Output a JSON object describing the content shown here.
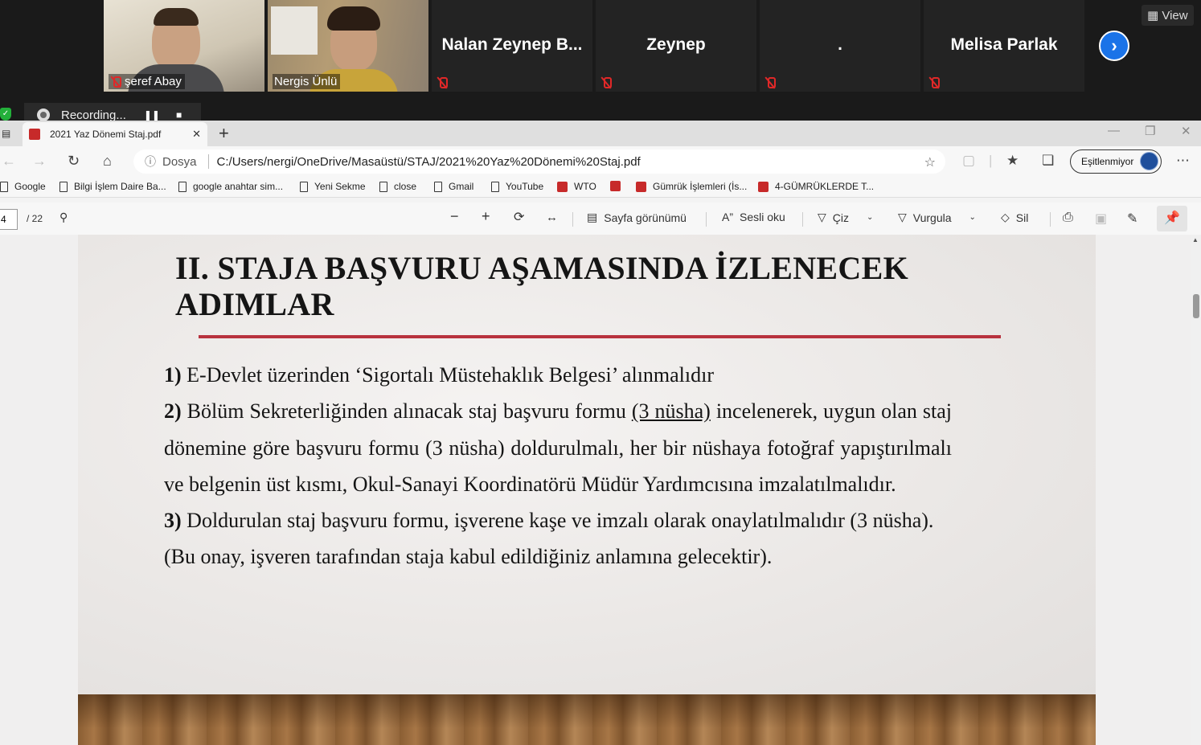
{
  "zoom": {
    "participants": [
      {
        "name": "şeref Abay",
        "muted": true
      },
      {
        "name": "Nergis Ünlü",
        "muted": false
      },
      {
        "name": "Nalan Zeynep B...",
        "muted": true
      },
      {
        "name": "Zeynep",
        "muted": true
      },
      {
        "name": ".",
        "muted": true
      },
      {
        "name": "Melisa Parlak",
        "muted": true
      }
    ],
    "view_label": "View",
    "recording_label": "Recording...",
    "next_icon": "chevron-right-icon"
  },
  "browser": {
    "tab_title": "2021 Yaz Dönemi Staj.pdf",
    "address": {
      "scheme_label": "Dosya",
      "url": "C:/Users/nergi/OneDrive/Masaüstü/STAJ/2021%20Yaz%20Dönemi%20Staj.pdf"
    },
    "profile_label": "Eşitlenmiyor",
    "bookmarks": [
      {
        "label": "Google",
        "icon": "doc"
      },
      {
        "label": "Bilgi İşlem Daire Ba...",
        "icon": "doc"
      },
      {
        "label": "google anahtar sim...",
        "icon": "doc"
      },
      {
        "label": "Yeni Sekme",
        "icon": "doc"
      },
      {
        "label": "close",
        "icon": "doc"
      },
      {
        "label": "Gmail",
        "icon": "doc"
      },
      {
        "label": "YouTube",
        "icon": "doc"
      },
      {
        "label": "WTO",
        "icon": "pdf"
      },
      {
        "label": "",
        "icon": "pdf"
      },
      {
        "label": "Gümrük İşlemleri (İs...",
        "icon": "pdf"
      },
      {
        "label": "4-GÜMRÜKLERDE T...",
        "icon": "pdf"
      }
    ],
    "pdf_toolbar": {
      "current_page": "4",
      "total_pages": "/ 22",
      "page_view_label": "Sayfa görünümü",
      "read_aloud_label": "Sesli oku",
      "draw_label": "Çiz",
      "highlight_label": "Vurgula",
      "erase_label": "Sil"
    }
  },
  "slide": {
    "title_line1": "II. STAJA BAŞVURU AŞAMASINDA İZLENECEK",
    "title_line2": "ADIMLAR",
    "accent_color": "#b8323e",
    "item1_num": "1)",
    "item1_text": " E-Devlet üzerinden ‘Sigortalı Müstehaklık Belgesi’ alınmalıdır",
    "item2_num": "2)",
    "item2_pre": " Bölüm Sekreterliğinden alınacak staj başvuru formu ",
    "item2_underlined": "(3 nüsha)",
    "item2_post": " incelenerek, uygun olan staj dönemine göre başvuru formu (3 nüsha) doldurulmalı, her bir nüshaya fotoğraf yapıştırılmalı ve belgenin üst kısmı, Okul-Sanayi Koordinatörü Müdür Yardımcısına imzalatılmalıdır.",
    "item3_num": "3)",
    "item3_text": " Doldurulan staj başvuru formu, işverene kaşe ve imzalı olarak onaylatılmalıdır (3 nüsha).",
    "note": "(Bu onay, işveren tarafından staja kabul edildiğiniz anlamına gelecektir)."
  }
}
